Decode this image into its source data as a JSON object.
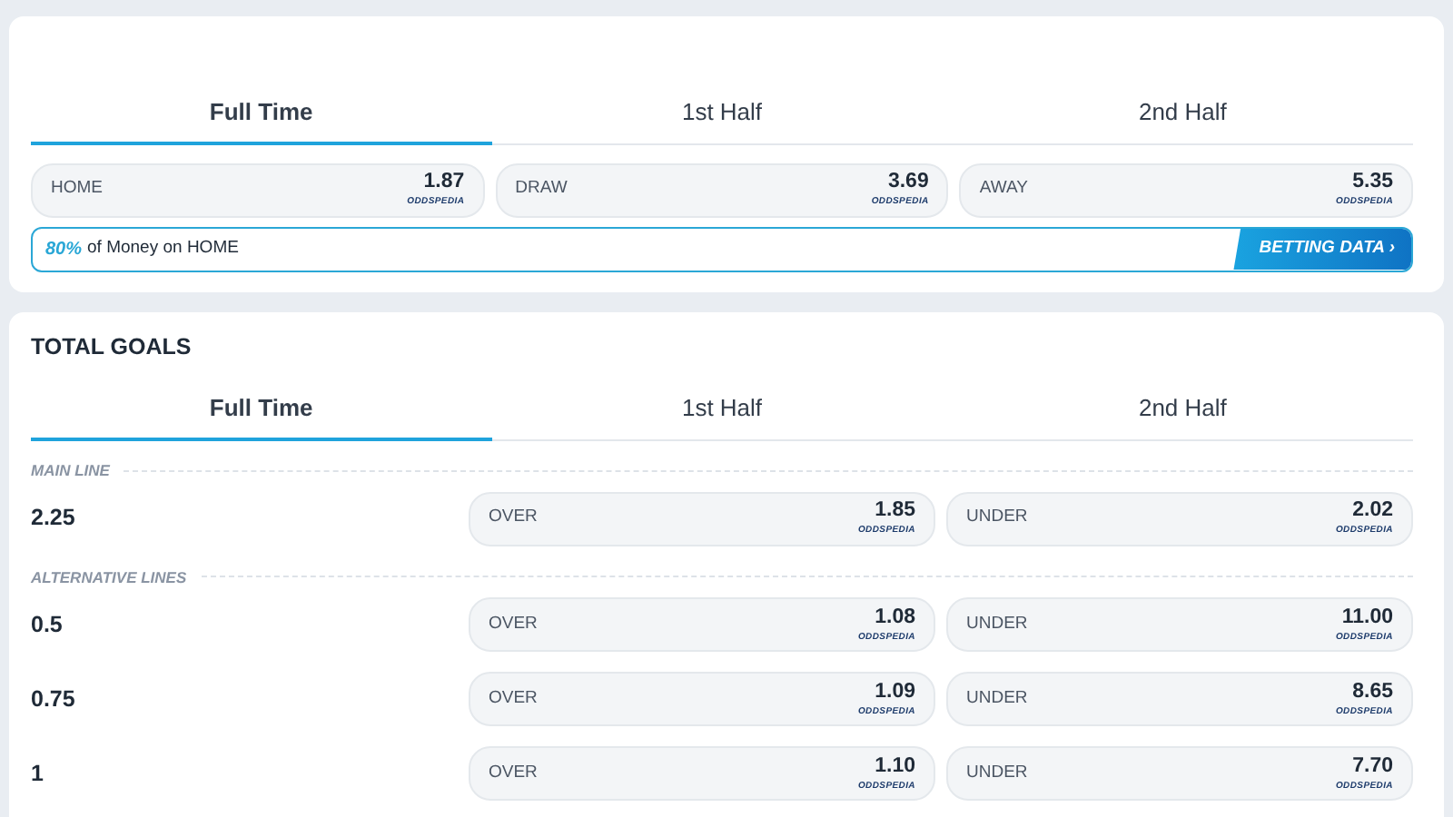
{
  "match_result": {
    "tabs": [
      {
        "label": "Full Time",
        "selected": true
      },
      {
        "label": "1st Half",
        "selected": false
      },
      {
        "label": "2nd Half",
        "selected": false
      }
    ],
    "odds": [
      {
        "label": "HOME",
        "value": "1.87",
        "provider": "ODDSPEDIA"
      },
      {
        "label": "DRAW",
        "value": "3.69",
        "provider": "ODDSPEDIA"
      },
      {
        "label": "AWAY",
        "value": "5.35",
        "provider": "ODDSPEDIA"
      }
    ],
    "money_bar": {
      "percent": "80%",
      "text": "of Money on HOME",
      "button": "BETTING DATA ›"
    }
  },
  "total_goals": {
    "title": "TOTAL GOALS",
    "tabs": [
      {
        "label": "Full Time",
        "selected": true
      },
      {
        "label": "1st Half",
        "selected": false
      },
      {
        "label": "2nd Half",
        "selected": false
      }
    ],
    "sections": [
      {
        "heading": "MAIN LINE",
        "lines": [
          {
            "line": "2.25",
            "over": {
              "label": "OVER",
              "value": "1.85",
              "provider": "ODDSPEDIA"
            },
            "under": {
              "label": "UNDER",
              "value": "2.02",
              "provider": "ODDSPEDIA"
            }
          }
        ]
      },
      {
        "heading": "ALTERNATIVE LINES",
        "lines": [
          {
            "line": "0.5",
            "over": {
              "label": "OVER",
              "value": "1.08",
              "provider": "ODDSPEDIA"
            },
            "under": {
              "label": "UNDER",
              "value": "11.00",
              "provider": "ODDSPEDIA"
            }
          },
          {
            "line": "0.75",
            "over": {
              "label": "OVER",
              "value": "1.09",
              "provider": "ODDSPEDIA"
            },
            "under": {
              "label": "UNDER",
              "value": "8.65",
              "provider": "ODDSPEDIA"
            }
          },
          {
            "line": "1",
            "over": {
              "label": "OVER",
              "value": "1.10",
              "provider": "ODDSPEDIA"
            },
            "under": {
              "label": "UNDER",
              "value": "7.70",
              "provider": "ODDSPEDIA"
            }
          }
        ]
      }
    ]
  }
}
